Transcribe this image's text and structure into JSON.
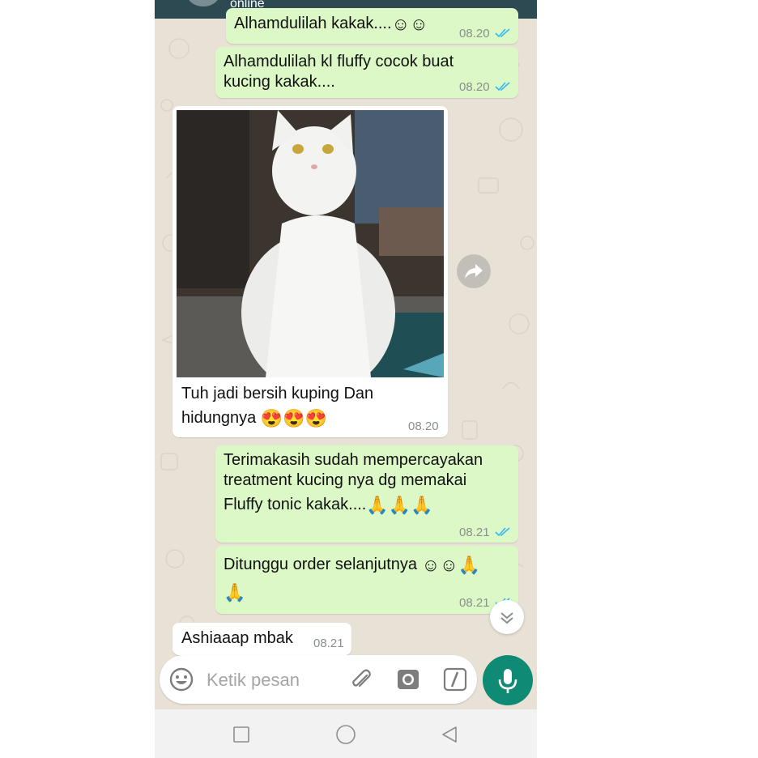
{
  "header": {
    "status": "online"
  },
  "messages": [
    {
      "id": "m1",
      "direction": "out",
      "text": "Alhamdulilah kakak....",
      "emoji": "☺☺",
      "time": "08.20",
      "read": true
    },
    {
      "id": "m2",
      "direction": "out",
      "line1": "Alhamdulilah kl fluffy cocok buat",
      "line2": "kucing kakak....",
      "time": "08.20",
      "read": true
    },
    {
      "id": "m3",
      "direction": "in",
      "image": "white-fluffy-cat-photo",
      "line1": "Tuh jadi bersih kuping Dan",
      "line2": "hidungnya",
      "emoji": "😍😍😍",
      "time": "08.20"
    },
    {
      "id": "m4",
      "direction": "out",
      "line1": "Terimakasih sudah mempercayakan",
      "line2": "treatment kucing nya dg memakai",
      "line3": "Fluffy tonic kakak....",
      "emoji": "🙏🙏🙏",
      "time": "08.21",
      "read": true
    },
    {
      "id": "m5",
      "direction": "out",
      "line1": "Ditunggu order selanjutnya",
      "emoji1": "☺☺🙏",
      "emoji2": "🙏",
      "time": "08.21",
      "read": true
    },
    {
      "id": "m6",
      "direction": "in",
      "text": "Ashiaaap mbak",
      "time": "08.21"
    }
  ],
  "composer": {
    "placeholder": "Ketik pesan"
  },
  "icons": [
    "emoji-icon",
    "attach-icon",
    "camera-icon",
    "payment-icon",
    "mic-icon",
    "share-icon",
    "scroll-down-icon",
    "nav-recent-icon",
    "nav-home-icon",
    "nav-back-icon"
  ],
  "colors": {
    "outgoing_bubble": "#dcf8c6",
    "incoming_bubble": "#ffffff",
    "header": "#2d4a52",
    "mic_button": "#0f8a75",
    "read_ticks": "#34b7f1",
    "wallpaper": "#e8e1d6"
  }
}
